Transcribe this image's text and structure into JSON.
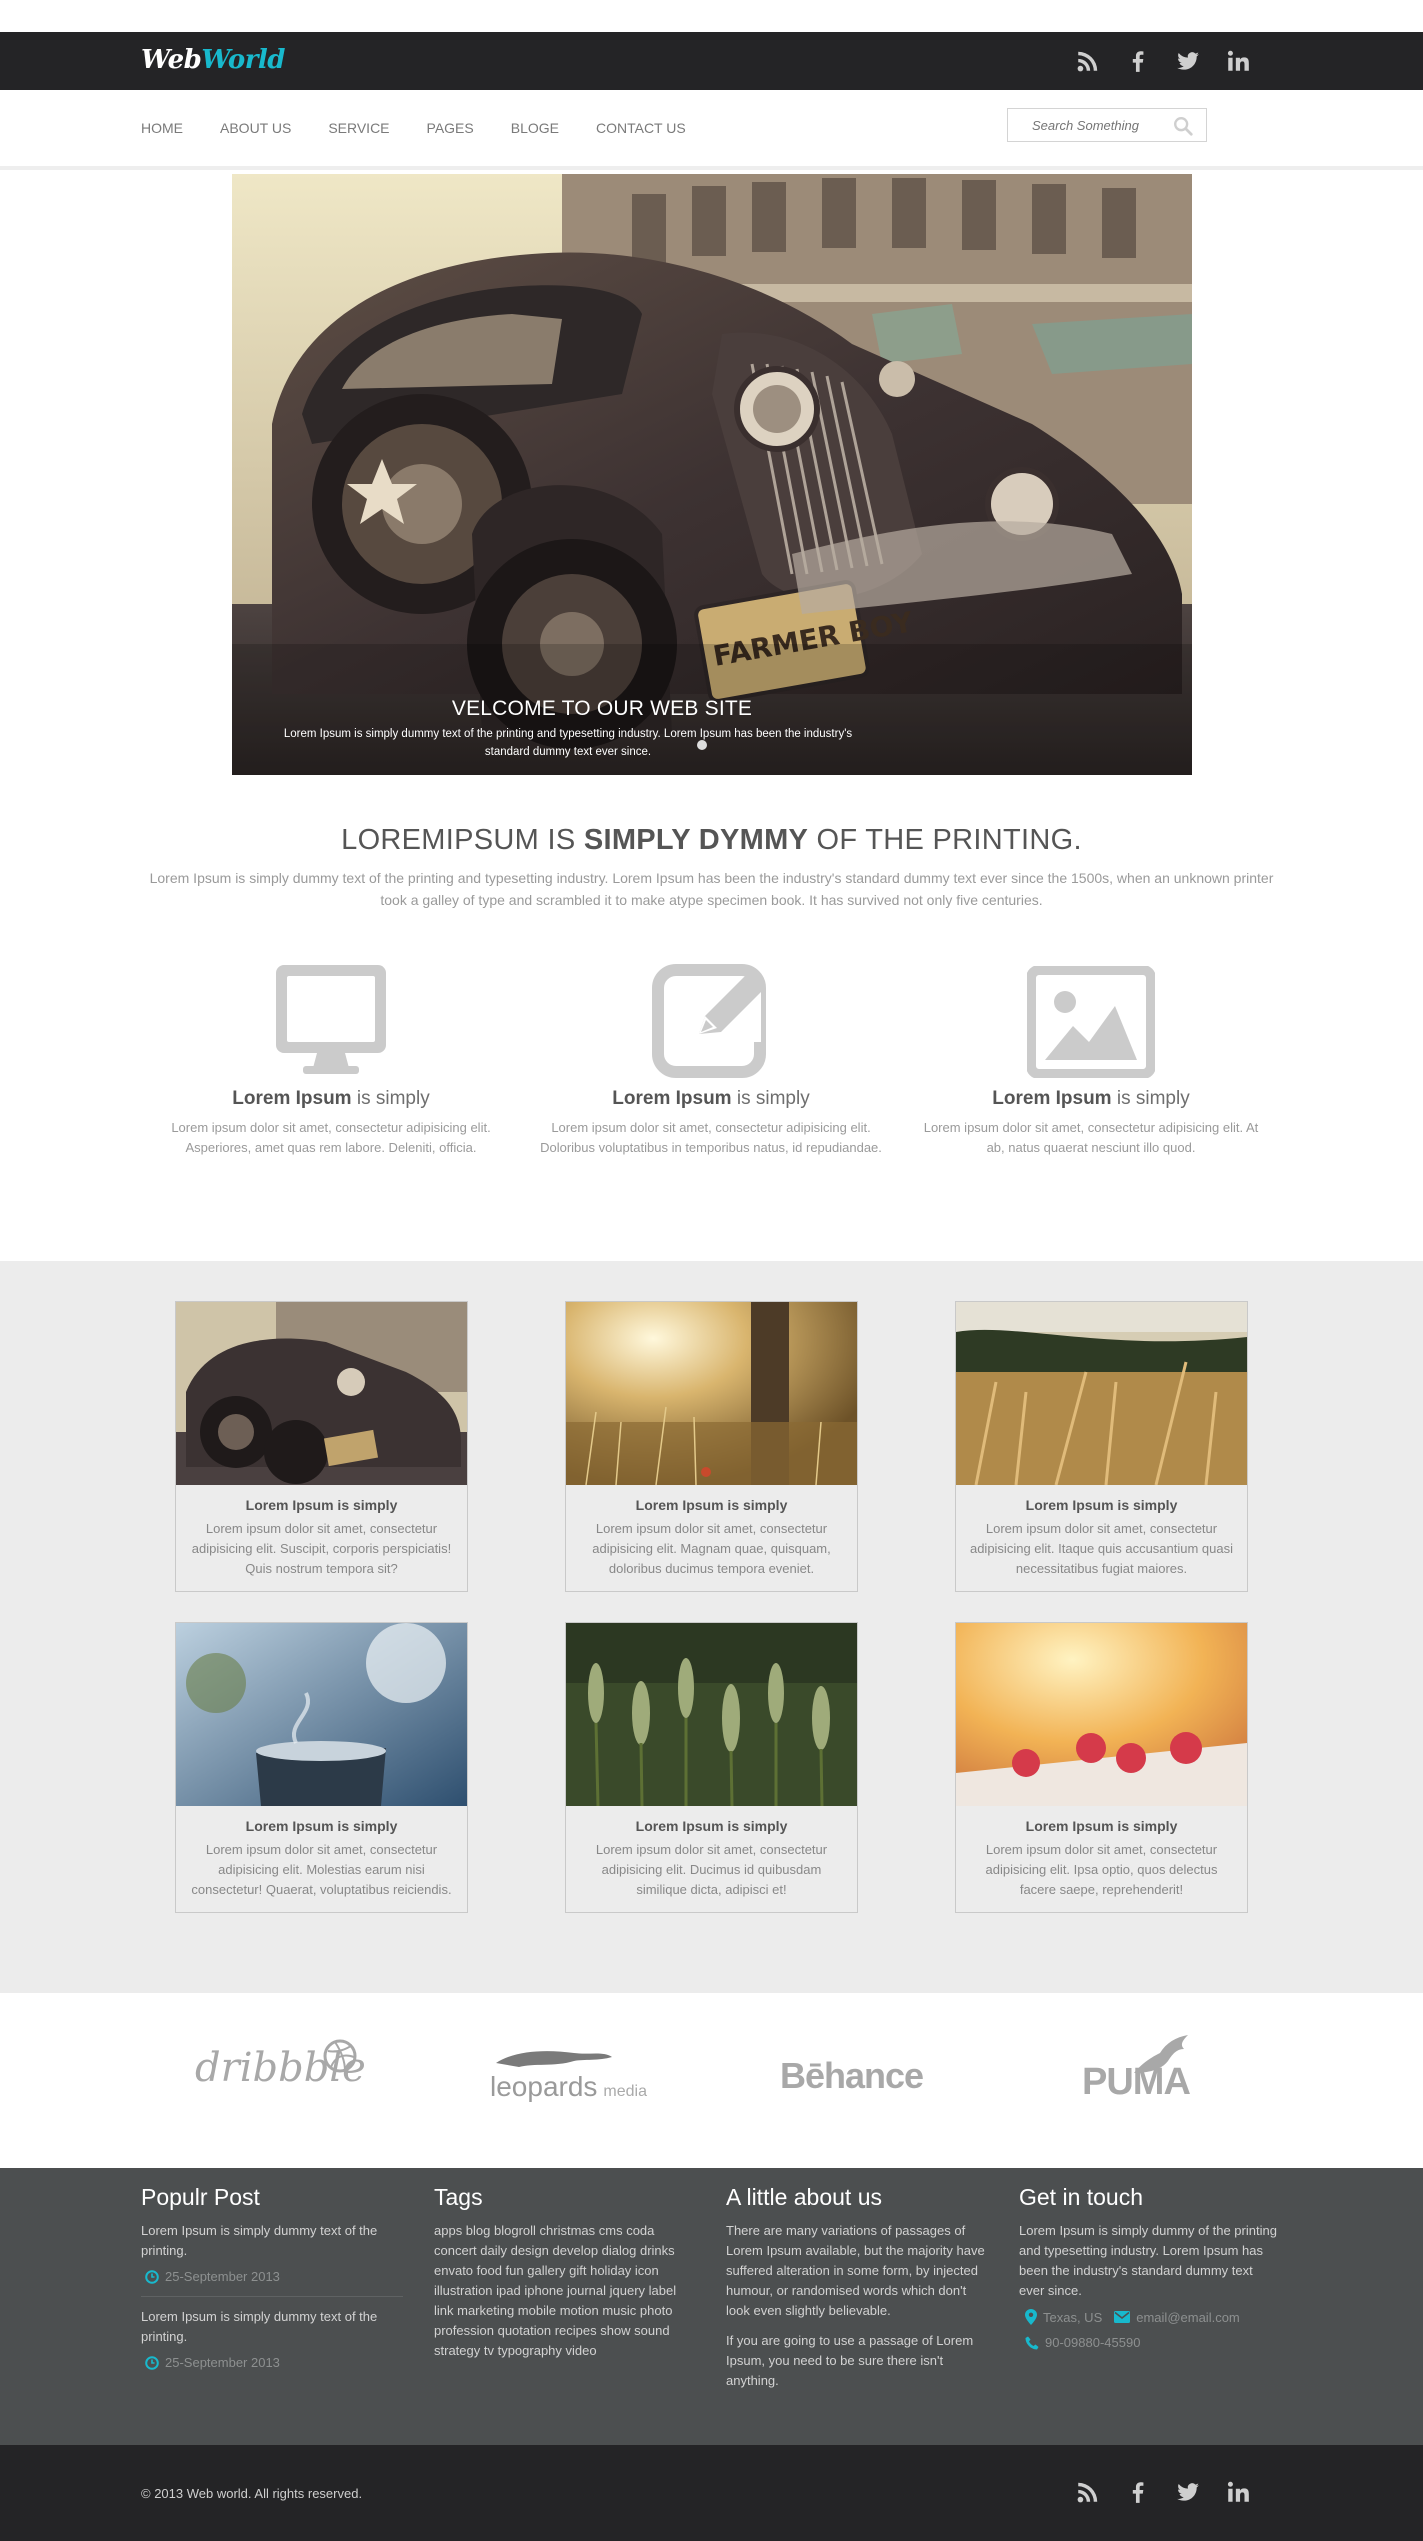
{
  "header": {
    "logo_part1": "Web",
    "logo_part2": "World",
    "social": [
      "rss-icon",
      "facebook-icon",
      "twitter-icon",
      "linkedin-icon"
    ]
  },
  "nav": {
    "items": [
      "HOME",
      "ABOUT US",
      "SERVICE",
      "PAGES",
      "BLOGE",
      "CONTACT US"
    ],
    "search_placeholder": "Search Something"
  },
  "hero": {
    "title": "VELCOME TO OUR WEB SITE",
    "text": "Lorem Ipsum is simply dummy text of the printing and typesetting industry. Lorem Ipsum has been the industry's standard dummy text ever since.",
    "plate_text": "FARMER BOY"
  },
  "intro": {
    "title_pre": "LOREMIPSUM IS ",
    "title_bold": "SIMPLY DYMMY",
    "title_post": " OF THE PRINTING.",
    "text": "Lorem Ipsum is simply dummy text of the printing and typesetting industry. Lorem Ipsum has been the industry's standard dummy text ever since the 1500s, when an unknown printer took a galley of type and scrambled it to make atype specimen book. It has survived not only five centuries."
  },
  "features": [
    {
      "icon": "monitor-icon",
      "title_bold": "Lorem Ipsum",
      "title_rest": " is simply",
      "text": "Lorem ipsum dolor sit amet, consectetur adipisicing elit. Asperiores, amet quas rem labore. Deleniti, officia."
    },
    {
      "icon": "edit-icon",
      "title_bold": "Lorem Ipsum",
      "title_rest": " is simply",
      "text": "Lorem ipsum dolor sit amet, consectetur adipisicing elit. Doloribus voluptatibus in temporibus natus, id repudiandae."
    },
    {
      "icon": "picture-icon",
      "title_bold": "Lorem Ipsum",
      "title_rest": " is simply",
      "text": "Lorem ipsum dolor sit amet, consectetur adipisicing elit. At ab, natus quaerat nesciunt illo quod."
    }
  ],
  "gallery": [
    {
      "title": "Lorem Ipsum is simply",
      "text": "Lorem ipsum dolor sit amet, consectetur adipisicing elit. Suscipit, corporis perspiciatis! Quis nostrum tempora sit?"
    },
    {
      "title": "Lorem Ipsum is simply",
      "text": "Lorem ipsum dolor sit amet, consectetur adipisicing elit. Magnam quae, quisquam, doloribus ducimus tempora eveniet."
    },
    {
      "title": "Lorem Ipsum is simply",
      "text": "Lorem ipsum dolor sit amet, consectetur adipisicing elit. Itaque quis accusantium quasi necessitatibus fugiat maiores."
    },
    {
      "title": "Lorem Ipsum is simply",
      "text": "Lorem ipsum dolor sit amet, consectetur adipisicing elit. Molestias earum nisi consectetur! Quaerat, voluptatibus reiciendis."
    },
    {
      "title": "Lorem Ipsum is simply",
      "text": "Lorem ipsum dolor sit amet, consectetur adipisicing elit. Ducimus id quibusdam similique dicta, adipisci et!"
    },
    {
      "title": "Lorem Ipsum is simply",
      "text": "Lorem ipsum dolor sit amet, consectetur adipisicing elit. Ipsa optio, quos delectus facere saepe, reprehenderit!"
    }
  ],
  "brands": {
    "dribbble": "dribbble",
    "leopards": "leopards",
    "leopards_sub": "media",
    "behance": "Bēhance",
    "puma": "PUMA"
  },
  "footer": {
    "popular": {
      "title": "Populr Post",
      "posts": [
        {
          "text": "Lorem Ipsum is simply dummy text of the printing.",
          "date": "25-September 2013"
        },
        {
          "text": "Lorem Ipsum is simply dummy text of the printing.",
          "date": "25-September 2013"
        }
      ]
    },
    "tags": {
      "title": "Tags",
      "text": "apps blog blogroll christmas cms coda concert daily design develop dialog drinks envato food fun gallery gift holiday icon illustration ipad iphone journal jquery label link marketing mobile motion music photo profession quotation recipes show sound strategy tv typography video"
    },
    "about": {
      "title": "A little about us",
      "p1": "There are many variations of passages of Lorem Ipsum available, but the majority have suffered alteration in some form, by injected humour, or randomised words which don't look even slightly believable.",
      "p2": "If you are going to use a passage of Lorem Ipsum, you need to be sure there isn't anything."
    },
    "contact": {
      "title": "Get in touch",
      "text": "Lorem Ipsum is simply dummy of the printing and typesetting industry. Lorem Ipsum has been the industry's standard dummy text ever since.",
      "location": "Texas, US",
      "email": "email@email.com",
      "phone": "90-09880-45590"
    }
  },
  "bottom": {
    "copyright": "© 2013 Web world. All rights reserved."
  },
  "colors": {
    "accent": "#18b9cd",
    "dark": "#242426",
    "footer": "#4c4f50",
    "gallery_bg": "#ececec"
  }
}
